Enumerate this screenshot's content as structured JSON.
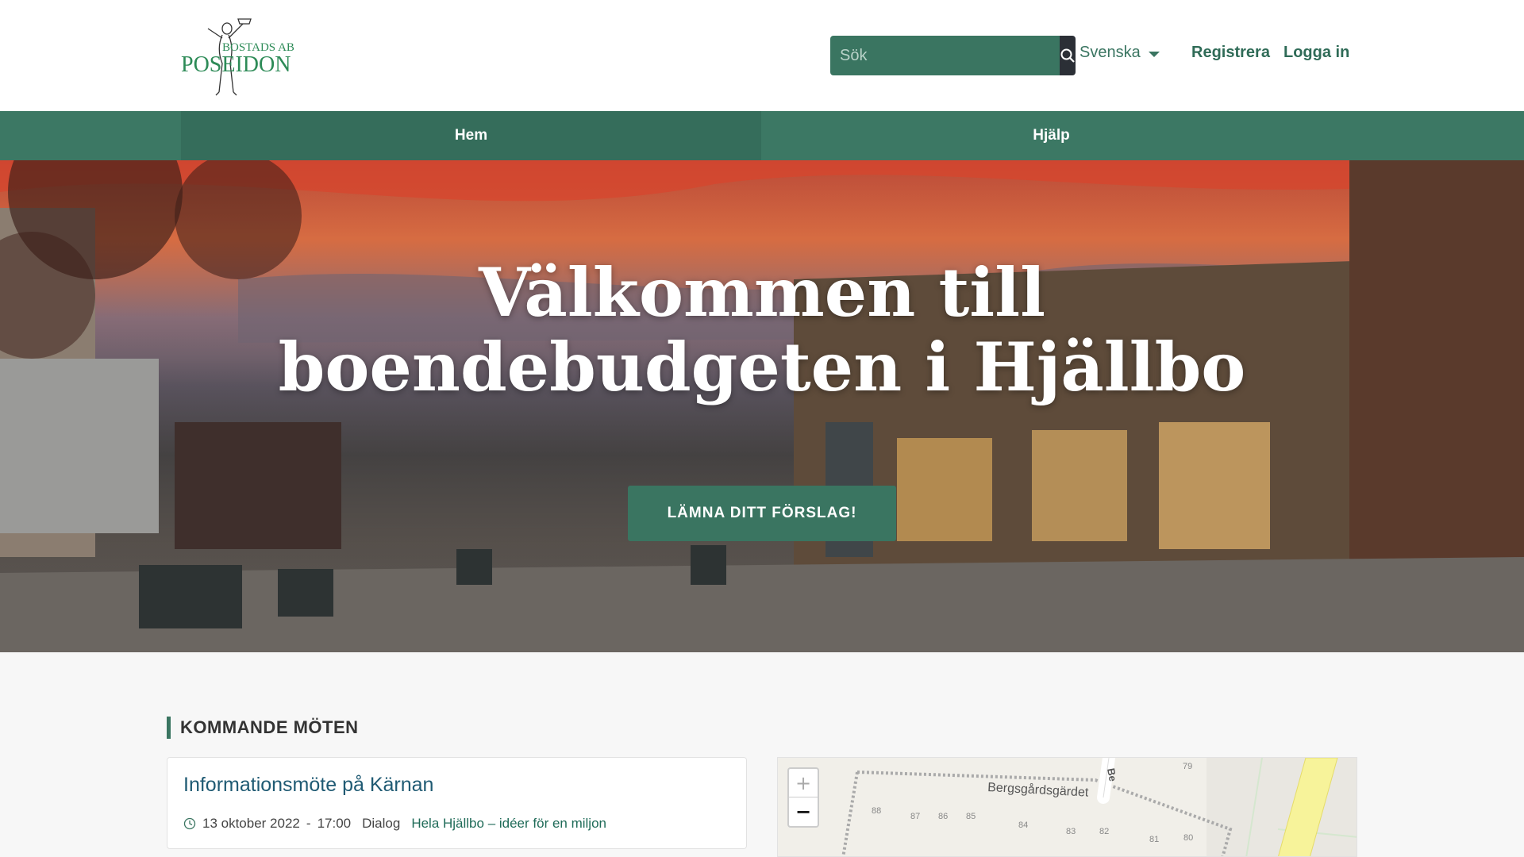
{
  "brand": {
    "logo_line1": "BOSTADS AB",
    "logo_line2": "POSEIDON"
  },
  "header": {
    "search_placeholder": "Sök",
    "language": "Svenska",
    "register": "Registrera",
    "login": "Logga in"
  },
  "nav": {
    "items": [
      {
        "label": "Hem"
      },
      {
        "label": "Hjälp"
      }
    ]
  },
  "hero": {
    "title_line1": "Välkommen till",
    "title_line2": "boendebudgeten i Hjällbo",
    "cta": "LÄMNA DITT FÖRSLAG!"
  },
  "meetings": {
    "heading": "KOMMANDE MÖTEN",
    "items": [
      {
        "title": "Informationsmöte på Kärnan",
        "date": "13 oktober 2022",
        "separator": "-",
        "time": "17:00",
        "type": "Dialog",
        "link": "Hela Hjällbo – idéer för en miljon"
      }
    ]
  },
  "map": {
    "zoom_in": "+",
    "zoom_out": "−",
    "street": "Bergsgårdsgärdet",
    "street_vertical": "Be",
    "numbers": [
      "79",
      "88",
      "87",
      "86",
      "85",
      "84",
      "83",
      "82",
      "81",
      "80"
    ]
  },
  "colors": {
    "brand": "#3a7561",
    "nav": "#3c7864",
    "dark": "#2b2f36"
  }
}
